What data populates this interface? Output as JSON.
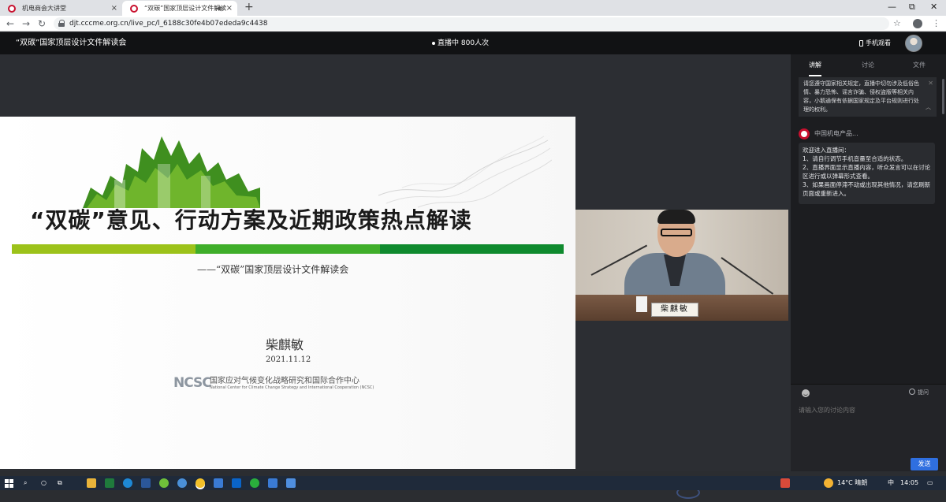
{
  "browser": {
    "tabs": [
      {
        "title": "机电商会大讲堂",
        "active": false
      },
      {
        "title": "“双碳”国家顶层设计文件解读",
        "active": true
      }
    ],
    "new_tab": "+",
    "window_controls": [
      "—",
      "⧉",
      "✕"
    ],
    "url": "djt.cccme.org.cn/live_pc/l_6188c30fe4b07ededa9c4438"
  },
  "header": {
    "title": "“双碳”国家顶层设计文件解读会",
    "live_status": "直播中 800人次",
    "mobile_watch": "手机观看"
  },
  "slide": {
    "title": "“双碳”意见、行动方案及近期政策热点解读",
    "subtitle": "——“双碳”国家顶层设计文件解读会",
    "speaker": "柴麒敏",
    "date": "2021.11.12",
    "org_logo": "NCSC",
    "org_name": "国家应对气候变化战略研究和国际合作中心",
    "org_name_en": "National Center for Climate Change Strategy and International Cooperation (NCSC)",
    "bar_colors": [
      "#9cc21a",
      "#3fae2a",
      "#0f8a2e"
    ]
  },
  "camera": {
    "nameplate": "柴麒敏"
  },
  "panel": {
    "tabs": [
      "讲解",
      "讨论",
      "文件"
    ],
    "active_tab": "讲解",
    "notice": "请您遵守国家相关规定，直播中切勿涉及低俗色情、暴力恐怖、谣言诈骗、侵权盗版等相关内容，小鹅通保有依据国家规定及平台规则进行处理的权利。",
    "message": {
      "sender": "中国机电产品...",
      "lines": [
        "欢迎进入直播间：",
        "1、请自行调节手机音量至合适的状态。",
        "2、直播界面显示直播内容，听众发言可以在讨论区进行或以弹幕形式查看。",
        "3、如果画面停滞不动或出现其他情况，请您刷新页面或重新进入。"
      ]
    },
    "ask_label": "提问",
    "input_placeholder": "请输入您的讨论内容",
    "send_label": "发送"
  },
  "taskbar": {
    "weather": "14°C  晴朗",
    "ime": "中",
    "time": "14:05"
  }
}
